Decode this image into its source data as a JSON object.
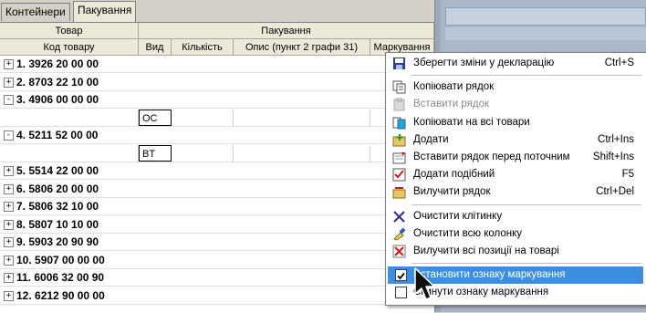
{
  "tabs": [
    "Контейнери",
    "Пакування"
  ],
  "header": {
    "group_tovar": "Товар",
    "group_pakuvannia": "Пакування",
    "col_code": "Код товару",
    "col_vyd": "Вид",
    "col_kilkist": "Кількість",
    "col_opys": "Опис (пункт 2 графи 31)",
    "col_markuvannia": "Маркування"
  },
  "rows": [
    {
      "kind": "item",
      "toggle": "+",
      "code": "1. 3926 20 00 00"
    },
    {
      "kind": "item",
      "toggle": "+",
      "code": "2. 8703 22 10 00"
    },
    {
      "kind": "item",
      "toggle": "-",
      "code": "3. 4906 00 00 00"
    },
    {
      "kind": "sub",
      "vyd": "OC"
    },
    {
      "kind": "item",
      "toggle": "-",
      "code": "4. 5211 52 00 00"
    },
    {
      "kind": "sub",
      "vyd": "BT"
    },
    {
      "kind": "item",
      "toggle": "+",
      "code": "5. 5514 22 00 00"
    },
    {
      "kind": "item",
      "toggle": "+",
      "code": "6. 5806 20 00 00"
    },
    {
      "kind": "item",
      "toggle": "+",
      "code": "7. 5806 32 10 00"
    },
    {
      "kind": "item",
      "toggle": "+",
      "code": "8. 5807 10 10 00"
    },
    {
      "kind": "item",
      "toggle": "+",
      "code": "9. 5903 20 90 90"
    },
    {
      "kind": "item",
      "toggle": "+",
      "code": "10. 5907 00 00 00"
    },
    {
      "kind": "item",
      "toggle": "+",
      "code": "11. 6006 32 00 90"
    },
    {
      "kind": "item",
      "toggle": "+",
      "code": "12. 6212 90 00 00"
    }
  ],
  "menu": [
    {
      "label": "Зберегти зміни у декларацію",
      "shortcut": "Ctrl+S",
      "icon": "save-icon",
      "state": "normal"
    },
    {
      "sep": true
    },
    {
      "label": "Копіювати рядок",
      "shortcut": "",
      "icon": "copy-icon",
      "state": "normal"
    },
    {
      "label": "Вставити рядок",
      "shortcut": "",
      "icon": "paste-icon",
      "state": "disabled"
    },
    {
      "label": "Копіювати на всі товари",
      "shortcut": "",
      "icon": "copy-all-icon",
      "state": "normal"
    },
    {
      "label": "Додати",
      "shortcut": "Ctrl+Ins",
      "icon": "add-icon",
      "state": "normal"
    },
    {
      "label": "Вставити рядок перед поточним",
      "shortcut": "Shift+Ins",
      "icon": "insert-before-icon",
      "state": "normal"
    },
    {
      "label": "Додати подібний",
      "shortcut": "F5",
      "icon": "add-similar-icon",
      "state": "normal"
    },
    {
      "label": "Вилучити рядок",
      "shortcut": "Ctrl+Del",
      "icon": "delete-row-icon",
      "state": "normal"
    },
    {
      "sep": true
    },
    {
      "label": "Очистити клітинку",
      "shortcut": "",
      "icon": "clear-cell-icon",
      "state": "normal"
    },
    {
      "label": "Очистити всю колонку",
      "shortcut": "",
      "icon": "clear-column-icon",
      "state": "normal"
    },
    {
      "label": "Вилучити всі позиції на товарі",
      "shortcut": "",
      "icon": "remove-all-icon",
      "state": "normal"
    },
    {
      "sep": true
    },
    {
      "label": "Встановити ознаку маркування",
      "shortcut": "",
      "icon": "checkbox-checked-icon",
      "state": "highlighted"
    },
    {
      "label": "Скинути ознаку маркування",
      "shortcut": "",
      "icon": "checkbox-empty-icon",
      "state": "normal"
    }
  ]
}
